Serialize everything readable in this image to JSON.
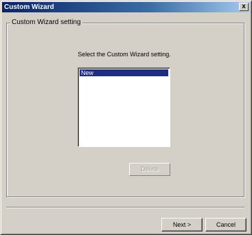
{
  "window": {
    "title": "Custom Wizard",
    "close_glyph": "x"
  },
  "group": {
    "legend": "Custom Wizard setting"
  },
  "main": {
    "instruction": "Select the Custom Wizard setting.",
    "list_items": [
      {
        "label": "New",
        "selected": true
      }
    ],
    "delete_label": "Delete"
  },
  "footer": {
    "next_label": "Next >",
    "cancel_label": "Cancel"
  },
  "colors": {
    "title_bar": "#0a246a",
    "selection": "#1f2e84",
    "dialog_face": "#d4d0c8"
  }
}
